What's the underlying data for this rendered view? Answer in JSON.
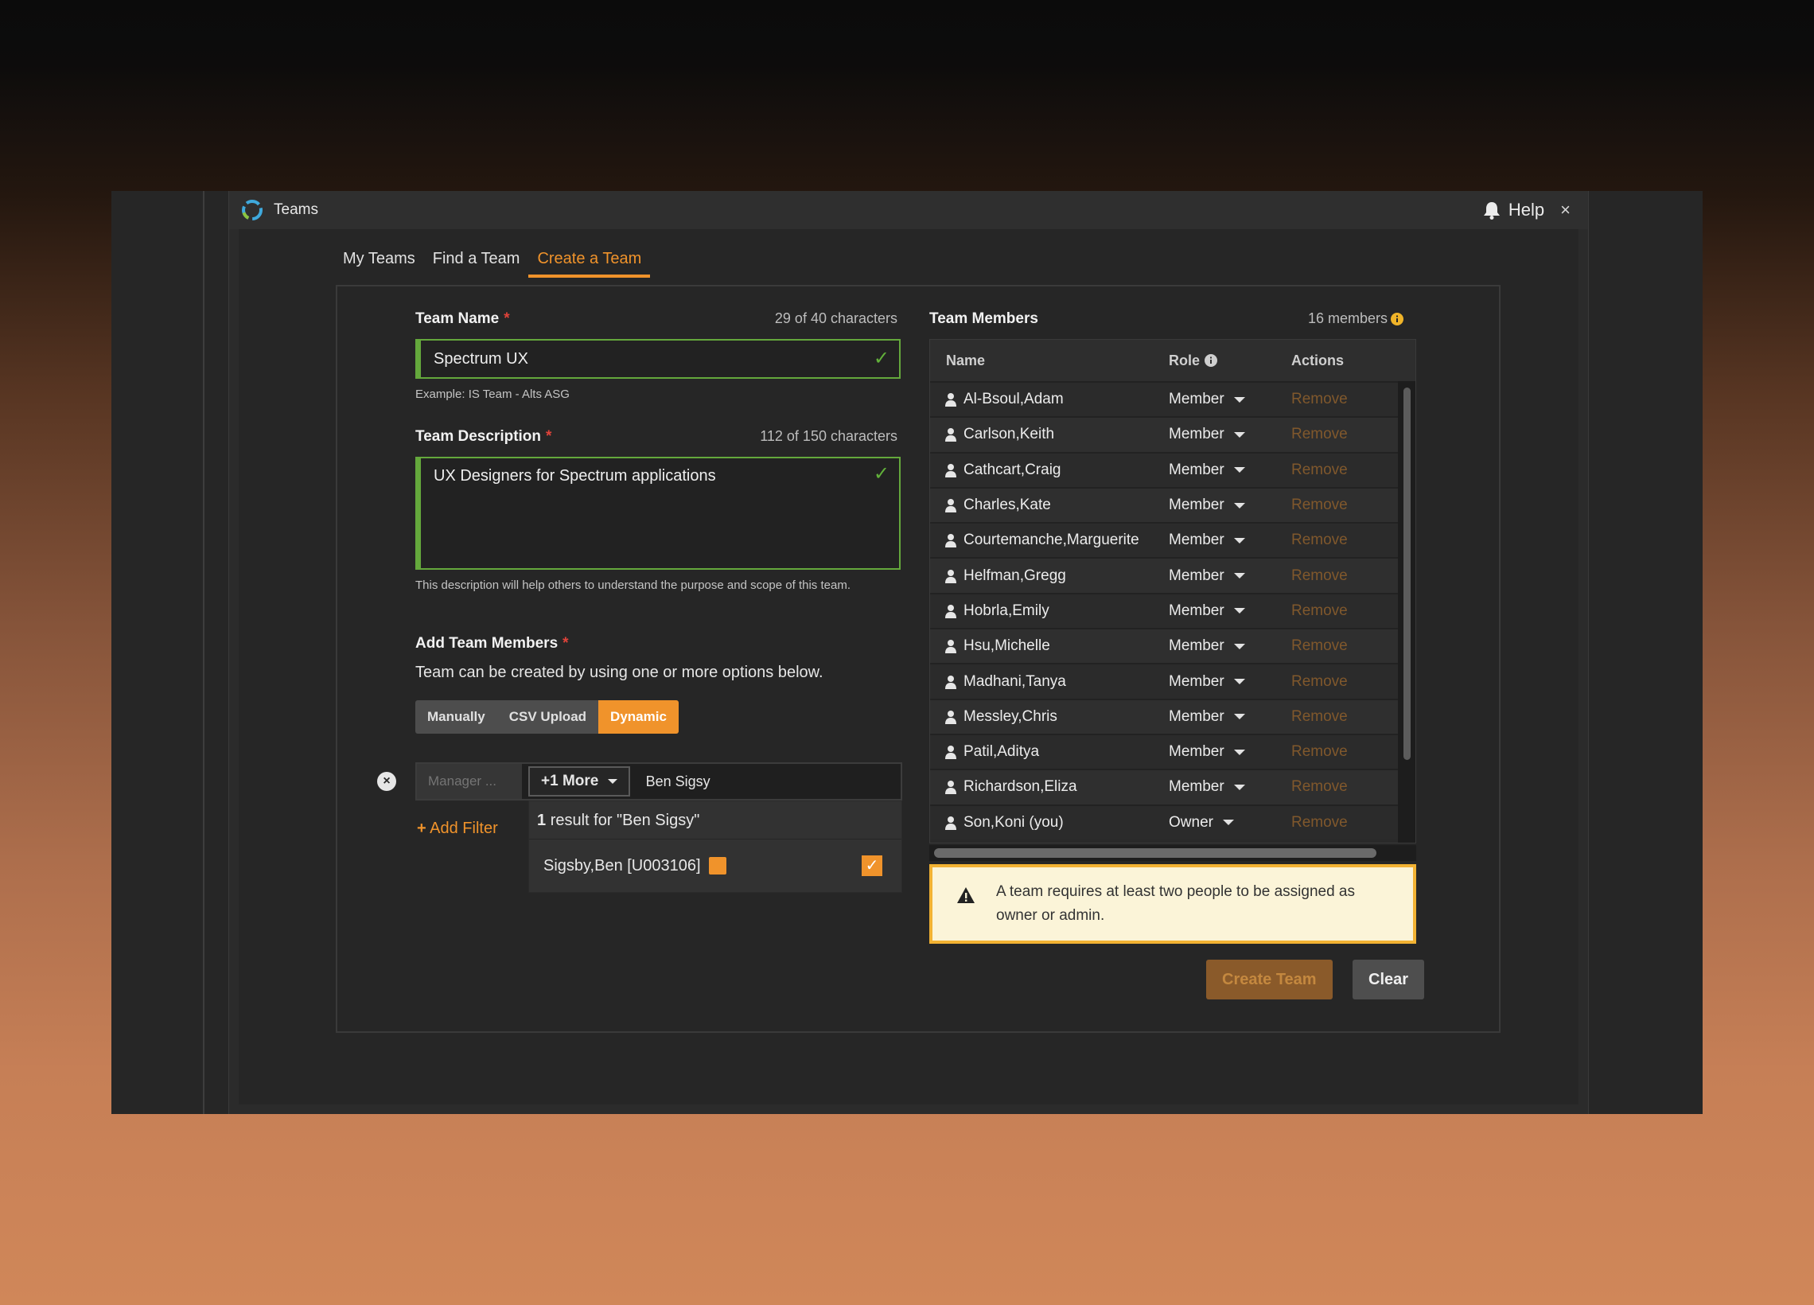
{
  "window": {
    "title": "Teams",
    "help_label": "Help",
    "close_glyph": "×"
  },
  "tabs": [
    {
      "label": "My Teams",
      "active": false
    },
    {
      "label": "Find a Team",
      "active": false
    },
    {
      "label": "Create a Team",
      "active": true
    }
  ],
  "form": {
    "team_name": {
      "label": "Team Name",
      "required_mark": "*",
      "count": "29 of 40 characters",
      "value": "Spectrum UX",
      "hint": "Example: IS Team - Alts ASG"
    },
    "team_description": {
      "label": "Team Description",
      "required_mark": "*",
      "count": "112 of 150 characters",
      "value": "UX Designers for Spectrum applications",
      "hint": "This description will help others to understand the purpose and scope of this team."
    },
    "add_members": {
      "label": "Add Team Members",
      "required_mark": "*",
      "description": "Team can be created by using one or more options below.",
      "modes": [
        "Manually",
        "CSV Upload",
        "Dynamic"
      ],
      "active_mode": "Dynamic"
    },
    "filter": {
      "manager_placeholder": "Manager ...",
      "more_label": "+1 More",
      "search_value": "Ben Sigsy",
      "add_filter_label": "Add Filter",
      "add_glyph": "+",
      "clear_glyph": "×"
    },
    "results": {
      "count": "1",
      "text": "result for \"Ben Sigsy\"",
      "items": [
        {
          "label": "Sigsby,Ben [U003106]",
          "checked": true
        }
      ]
    }
  },
  "members": {
    "title": "Team Members",
    "count": "16 members",
    "columns": {
      "name": "Name",
      "role": "Role",
      "actions": "Actions"
    },
    "rows": [
      {
        "name": "Al-Bsoul,Adam",
        "role": "Member",
        "action": "Remove"
      },
      {
        "name": "Carlson,Keith",
        "role": "Member",
        "action": "Remove"
      },
      {
        "name": "Cathcart,Craig",
        "role": "Member",
        "action": "Remove"
      },
      {
        "name": "Charles,Kate",
        "role": "Member",
        "action": "Remove"
      },
      {
        "name": "Courtemanche,Marguerite",
        "role": "Member",
        "action": "Remove"
      },
      {
        "name": "Helfman,Gregg",
        "role": "Member",
        "action": "Remove"
      },
      {
        "name": "Hobrla,Emily",
        "role": "Member",
        "action": "Remove"
      },
      {
        "name": "Hsu,Michelle",
        "role": "Member",
        "action": "Remove"
      },
      {
        "name": "Madhani,Tanya",
        "role": "Member",
        "action": "Remove"
      },
      {
        "name": "Messley,Chris",
        "role": "Member",
        "action": "Remove"
      },
      {
        "name": "Patil,Aditya",
        "role": "Member",
        "action": "Remove"
      },
      {
        "name": "Richardson,Eliza",
        "role": "Member",
        "action": "Remove"
      },
      {
        "name": "Son,Koni (you)",
        "role": "Owner",
        "action": "Remove"
      }
    ],
    "warning": "A team requires at least two people to be assigned as owner or admin."
  },
  "actions": {
    "create_label": "Create Team",
    "clear_label": "Clear"
  },
  "colors": {
    "accent": "#f0932b",
    "valid": "#64a83c",
    "required": "#e0433a",
    "warning_border": "#f2b233",
    "warning_bg": "#fbf4d8"
  }
}
